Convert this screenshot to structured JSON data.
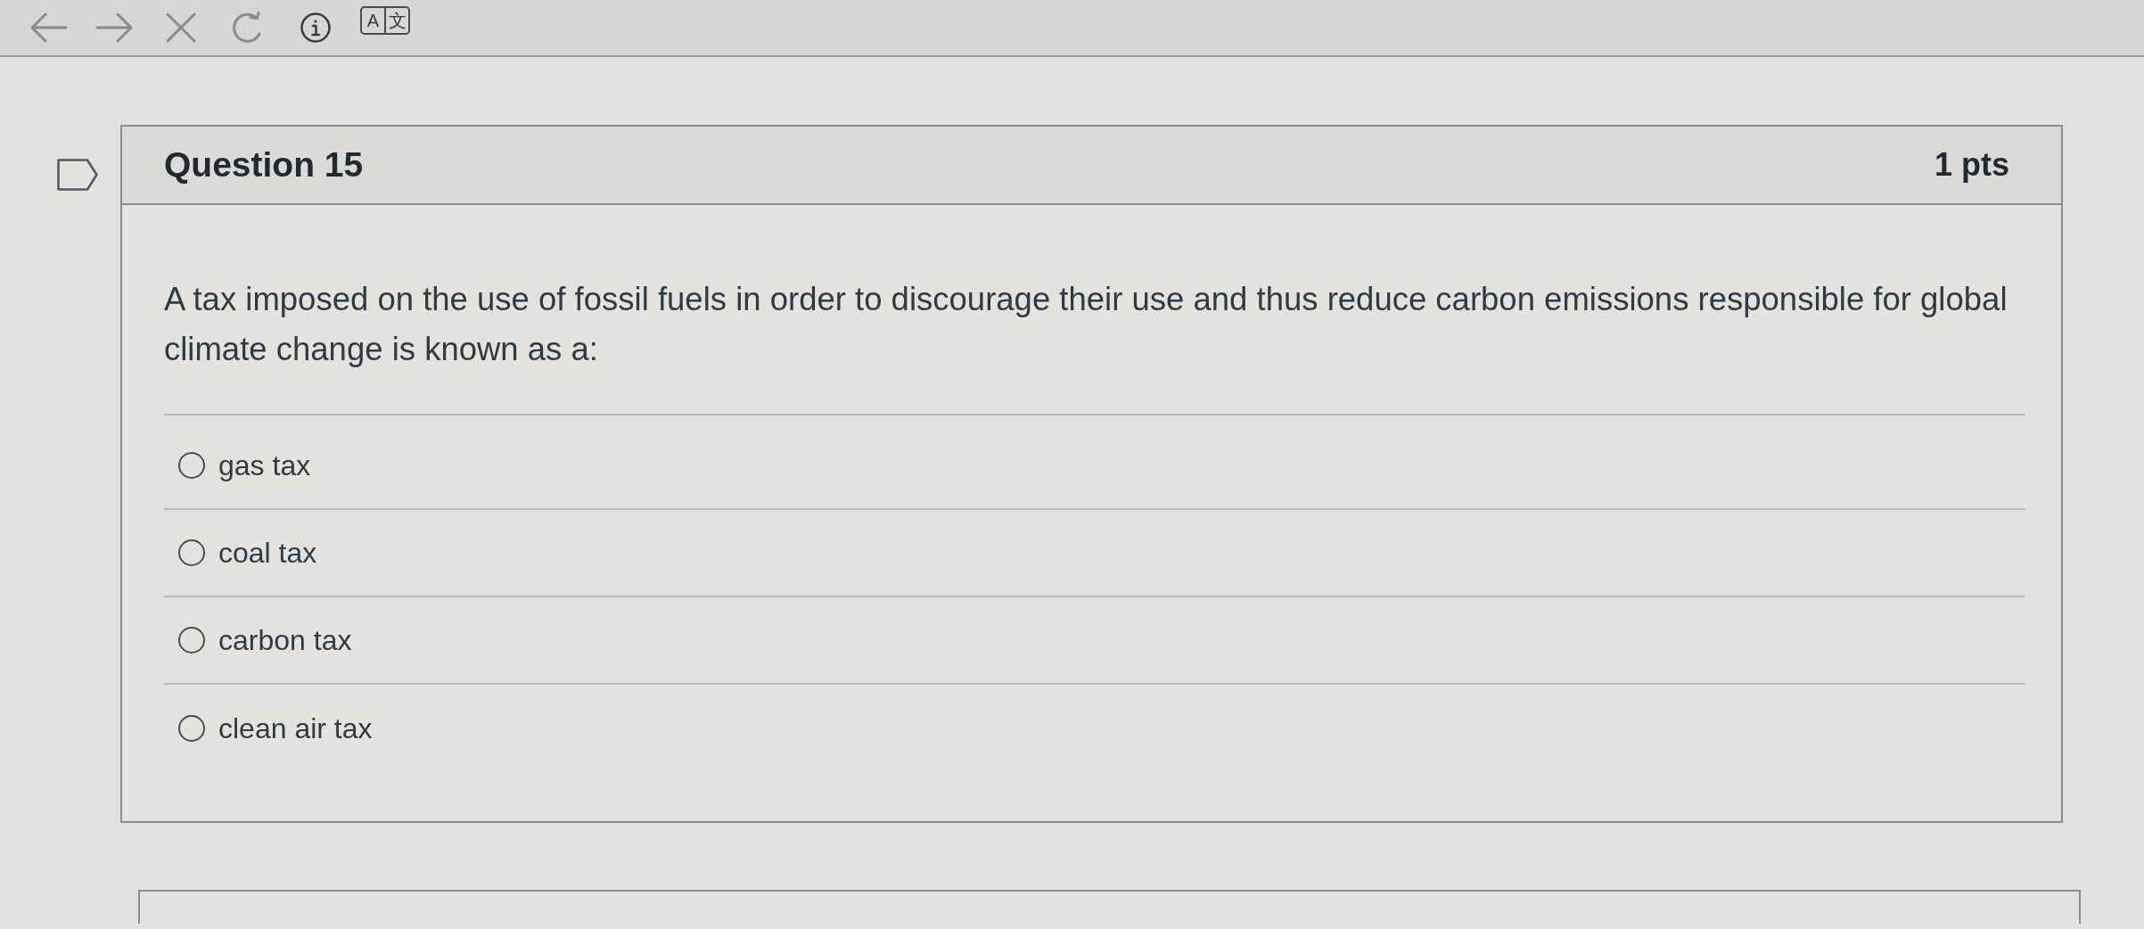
{
  "toolbar": {
    "translate_button": [
      "A",
      "文"
    ]
  },
  "question": {
    "flagged": false,
    "title": "Question 15",
    "points": "1 pts",
    "text": "A tax imposed on the use of fossil fuels in order to discourage their use and thus reduce carbon emissions responsible for global climate change is known as a:",
    "options": [
      {
        "label": "gas tax",
        "selected": false
      },
      {
        "label": "coal tax",
        "selected": false
      },
      {
        "label": "carbon tax",
        "selected": false
      },
      {
        "label": "clean air tax",
        "selected": false
      }
    ]
  }
}
